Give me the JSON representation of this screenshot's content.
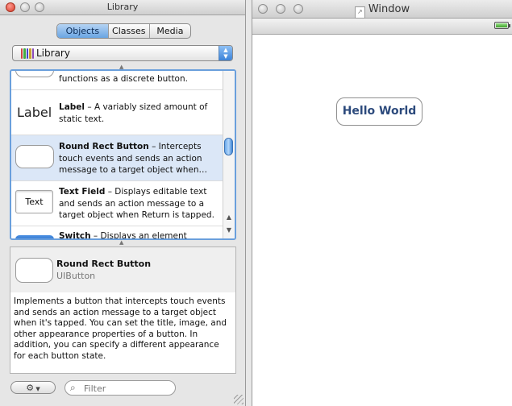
{
  "library": {
    "title": "Library",
    "tabs": [
      {
        "label": "Objects",
        "selected": true
      },
      {
        "label": "Classes",
        "selected": false
      },
      {
        "label": "Media",
        "selected": false
      }
    ],
    "popup": {
      "label": "Library",
      "icon": "books-icon"
    },
    "items": [
      {
        "name": "",
        "text": "functions as a discrete button."
      },
      {
        "name": "Label",
        "text": " – A variably sized amount of static text.",
        "thumb": "Label"
      },
      {
        "name": "Round Rect Button",
        "text": " – Intercepts touch events and sends an action message to a target object when…",
        "selected": true
      },
      {
        "name": "Text Field",
        "text": " – Displays editable text and sends an action message to a target object when Return is tapped.",
        "thumb": "Text"
      },
      {
        "name": "Switch",
        "text": " – Displays an element"
      }
    ],
    "detail": {
      "title": "Round Rect Button",
      "class": "UIButton",
      "description": "Implements a button that intercepts touch events and sends an action message to a target object when it's tapped. You can set the title, image, and other appearance properties of a button. In addition, you can specify a different appearance for each button state."
    },
    "filter": {
      "placeholder": "Filter",
      "value": ""
    },
    "gear_icon": "gear-icon",
    "accent": "#6a9fdc"
  },
  "window": {
    "title": "Window",
    "button_label": "Hello World",
    "button_color": "#2c4a7c"
  }
}
